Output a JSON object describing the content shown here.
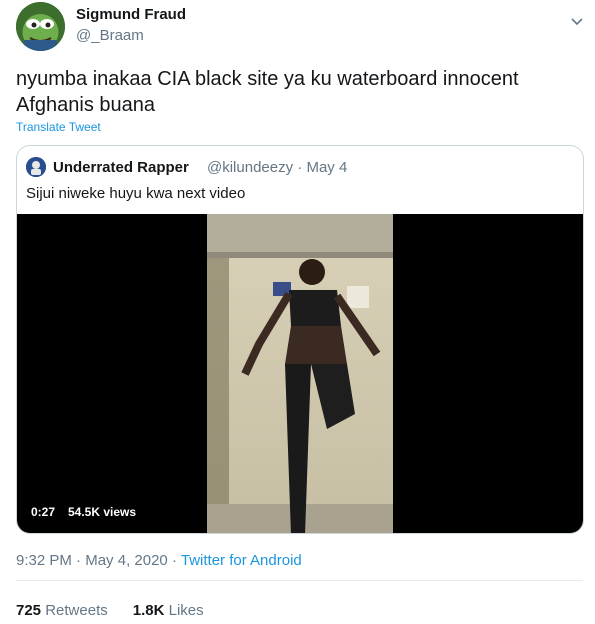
{
  "tweet": {
    "author_name": "Sigmund Fraud",
    "author_handle": "@_Braam",
    "text": "nyumba inakaa CIA black site ya ku waterboard innocent Afghanis buana",
    "translate_label": "Translate Tweet",
    "time": "9:32 PM",
    "date": "May 4, 2020",
    "source": "Twitter for Android",
    "retweets_count": "725",
    "retweets_label": "Retweets",
    "likes_count": "1.8K",
    "likes_label": "Likes"
  },
  "quote": {
    "author_name": "Underrated Rapper",
    "author_handle": "@kilundeezy",
    "date": "May 4",
    "text": "Sijui niweke huyu kwa next video",
    "video": {
      "duration": "0:27",
      "views": "54.5K views"
    }
  },
  "colors": {
    "link": "#1b95e0",
    "secondary_text": "#657786",
    "border": "#ccd6dd"
  },
  "icons": {
    "menu": "chevron-down-icon"
  }
}
